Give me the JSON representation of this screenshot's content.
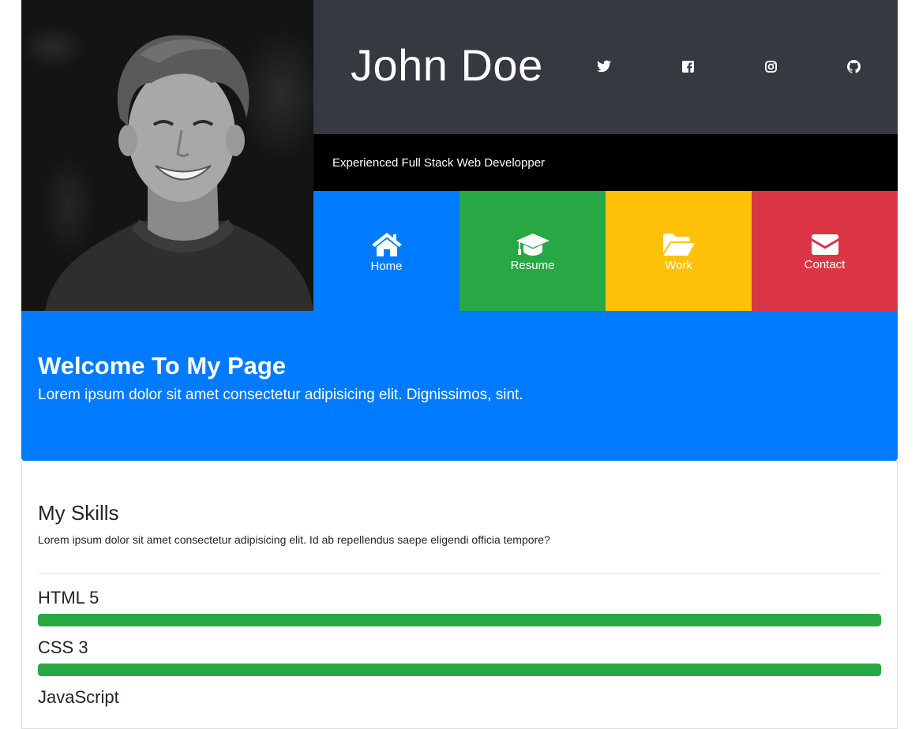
{
  "header": {
    "name": "John Doe",
    "tagline": "Experienced Full Stack Web Developper",
    "social": [
      {
        "icon": "twitter-icon"
      },
      {
        "icon": "facebook-icon"
      },
      {
        "icon": "instagram-icon"
      },
      {
        "icon": "github-icon"
      }
    ]
  },
  "nav": {
    "home": {
      "label": "Home",
      "icon": "home-icon",
      "color": "#007bff"
    },
    "resume": {
      "label": "Resume",
      "icon": "graduation-cap-icon",
      "color": "#28a745"
    },
    "work": {
      "label": "Work",
      "icon": "folder-open-icon",
      "color": "#ffc107"
    },
    "contact": {
      "label": "Contact",
      "icon": "envelope-icon",
      "color": "#dc3545"
    }
  },
  "welcome": {
    "title": "Welcome To My Page",
    "text": "Lorem ipsum dolor sit amet consectetur adipisicing elit. Dignissimos, sint."
  },
  "skills": {
    "title": "My Skills",
    "text": "Lorem ipsum dolor sit amet consectetur adipisicing elit. Id ab repellendus saepe eligendi officia tempore?",
    "items": [
      {
        "name": "HTML 5",
        "percent": 100,
        "color": "#28a745"
      },
      {
        "name": "CSS 3",
        "percent": 100,
        "color": "#28a745"
      },
      {
        "name": "JavaScript"
      }
    ]
  }
}
